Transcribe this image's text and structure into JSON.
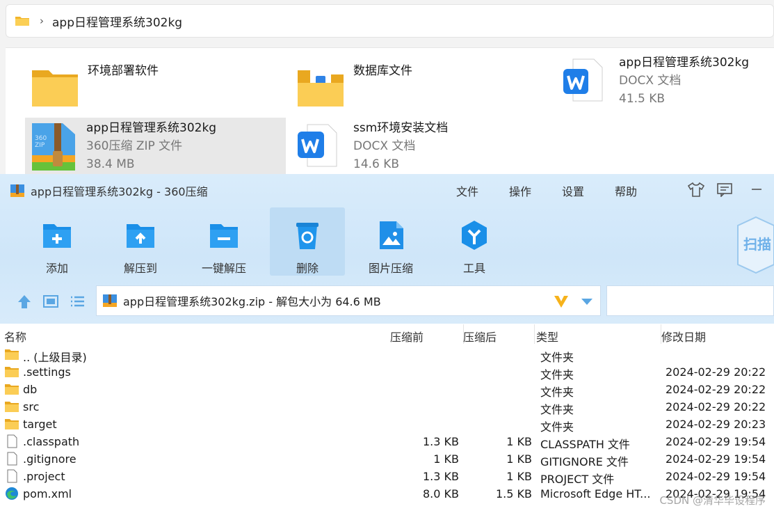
{
  "explorer": {
    "breadcrumb_sep": "›",
    "path": "app日程管理系统302kg",
    "items": [
      {
        "name": "环境部署软件",
        "line2": "",
        "line3": "",
        "icon": "folder-icon"
      },
      {
        "name": "数据库文件",
        "line2": "",
        "line3": "",
        "icon": "folder-doc-icon"
      },
      {
        "name": "app日程管理系统302kg",
        "line2": "DOCX 文档",
        "line3": "41.5 KB",
        "icon": "word-doc-icon"
      },
      {
        "name": "app日程管理系统302kg",
        "line2": "360压缩 ZIP 文件",
        "line3": "38.4 MB",
        "icon": "zip-archive-icon"
      },
      {
        "name": "ssm环境安装文档",
        "line2": "DOCX 文档",
        "line3": "14.6 KB",
        "icon": "word-doc-icon"
      }
    ]
  },
  "zip": {
    "title": "app日程管理系统302kg - 360压缩",
    "menu": [
      "文件",
      "操作",
      "设置",
      "帮助"
    ],
    "tools": [
      {
        "label": "添加",
        "icon": "add-icon"
      },
      {
        "label": "解压到",
        "icon": "extract-to-icon"
      },
      {
        "label": "一键解压",
        "icon": "one-click-extract-icon"
      },
      {
        "label": "删除",
        "icon": "delete-icon"
      },
      {
        "label": "图片压缩",
        "icon": "image-compress-icon"
      },
      {
        "label": "工具",
        "icon": "tools-icon"
      }
    ],
    "scan_label": "扫描",
    "path_text": "app日程管理系统302kg.zip - 解包大小为 64.6 MB",
    "columns": [
      "名称",
      "压缩前",
      "压缩后",
      "类型",
      "修改日期"
    ],
    "rows": [
      {
        "name": ".. (上级目录)",
        "before": "",
        "after": "",
        "type": "文件夹",
        "date": "",
        "icon": "folder-icon"
      },
      {
        "name": ".settings",
        "before": "",
        "after": "",
        "type": "文件夹",
        "date": "2024-02-29 20:22",
        "icon": "folder-icon"
      },
      {
        "name": "db",
        "before": "",
        "after": "",
        "type": "文件夹",
        "date": "2024-02-29 20:22",
        "icon": "folder-icon"
      },
      {
        "name": "src",
        "before": "",
        "after": "",
        "type": "文件夹",
        "date": "2024-02-29 20:22",
        "icon": "folder-icon"
      },
      {
        "name": "target",
        "before": "",
        "after": "",
        "type": "文件夹",
        "date": "2024-02-29 20:23",
        "icon": "folder-icon"
      },
      {
        "name": ".classpath",
        "before": "1.3 KB",
        "after": "1 KB",
        "type": "CLASSPATH 文件",
        "date": "2024-02-29 19:54",
        "icon": "file-icon"
      },
      {
        "name": ".gitignore",
        "before": "1 KB",
        "after": "1 KB",
        "type": "GITIGNORE 文件",
        "date": "2024-02-29 19:54",
        "icon": "file-icon"
      },
      {
        "name": ".project",
        "before": "1.3 KB",
        "after": "1 KB",
        "type": "PROJECT 文件",
        "date": "2024-02-29 19:54",
        "icon": "file-icon"
      },
      {
        "name": "pom.xml",
        "before": "8.0 KB",
        "after": "1.5 KB",
        "type": "Microsoft Edge HT...",
        "date": "2024-02-29 19:54",
        "icon": "edge-icon"
      }
    ],
    "watermark": "CSDN @清华毕设程序"
  },
  "colors": {
    "accent": "#1e90e8",
    "folder": "#f6c342",
    "window_header": "#d4e9fa"
  }
}
